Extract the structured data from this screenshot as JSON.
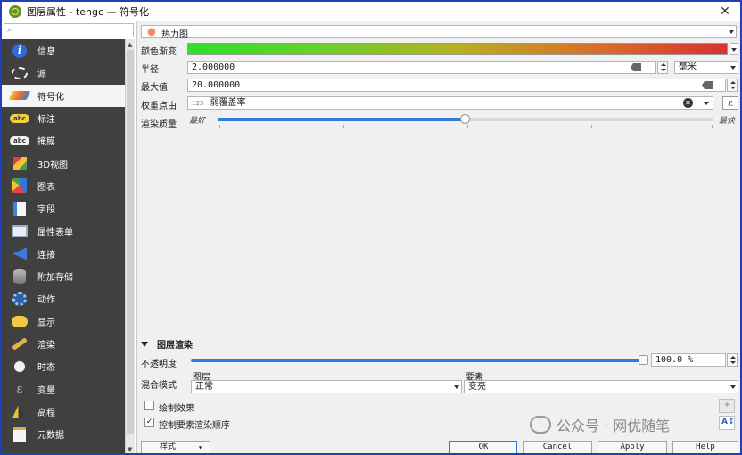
{
  "window": {
    "title": "图层属性 - tengc — 符号化"
  },
  "sidebar": {
    "search_placeholder": "",
    "items": [
      {
        "label": "信息",
        "icon": "info-icon"
      },
      {
        "label": "源",
        "icon": "source-icon"
      },
      {
        "label": "符号化",
        "icon": "symbology-icon",
        "selected": true
      },
      {
        "label": "标注",
        "icon": "labels-icon"
      },
      {
        "label": "掩膜",
        "icon": "mask-icon"
      },
      {
        "label": "3D视图",
        "icon": "3d-view-icon"
      },
      {
        "label": "图表",
        "icon": "diagrams-icon"
      },
      {
        "label": "字段",
        "icon": "fields-icon"
      },
      {
        "label": "属性表单",
        "icon": "attributes-form-icon"
      },
      {
        "label": "连接",
        "icon": "joins-icon"
      },
      {
        "label": "附加存储",
        "icon": "auxiliary-storage-icon"
      },
      {
        "label": "动作",
        "icon": "actions-icon"
      },
      {
        "label": "显示",
        "icon": "display-icon"
      },
      {
        "label": "渲染",
        "icon": "rendering-icon"
      },
      {
        "label": "时态",
        "icon": "temporal-icon"
      },
      {
        "label": "变量",
        "icon": "variables-icon"
      },
      {
        "label": "高程",
        "icon": "elevation-icon"
      },
      {
        "label": "元数据",
        "icon": "metadata-icon"
      }
    ]
  },
  "symbology": {
    "renderer": "热力图",
    "color_ramp_label": "颜色渐变",
    "radius_label": "半径",
    "radius_value": "2.000000",
    "radius_unit": "毫米",
    "max_label": "最大值",
    "max_value": "20.000000",
    "weight_label": "权重点由",
    "weight_type_badge": "123",
    "weight_field": "弱覆盖率",
    "quality_label": "渲染质量",
    "quality_best": "最好",
    "quality_fastest": "最快",
    "quality_level": 0.5
  },
  "layer_rendering": {
    "header": "图层渲染",
    "opacity_label": "不透明度",
    "opacity_value": "100.0 %",
    "opacity_level": 1.0,
    "blend_mode_label": "混合模式",
    "layer_label": "图层",
    "layer_blend": "正常",
    "feature_label": "要素",
    "feature_blend": "变亮",
    "draw_effects_label": "绘制效果",
    "draw_effects_checked": false,
    "control_order_label": "控制要素渲染顺序",
    "control_order_checked": true
  },
  "buttons": {
    "style": "样式",
    "ok": "OK",
    "cancel": "Cancel",
    "apply": "Apply",
    "help": "Help"
  },
  "watermark": "公众号 · 网优随笔"
}
